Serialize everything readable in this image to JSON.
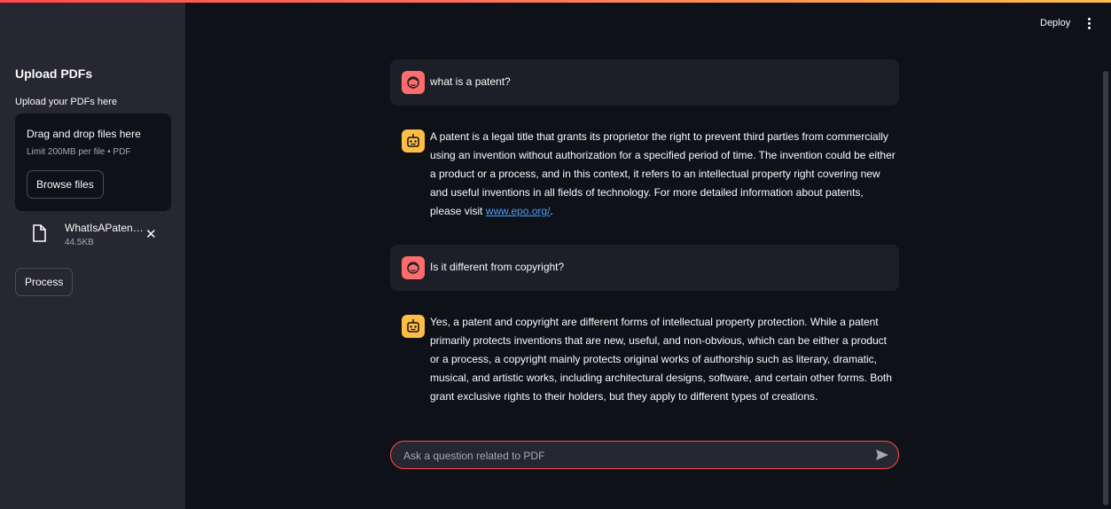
{
  "sidebar": {
    "title": "Upload PDFs",
    "upload_label": "Upload your PDFs here",
    "dropzone": {
      "title": "Drag and drop files here",
      "limit": "Limit 200MB per file • PDF",
      "browse_label": "Browse files"
    },
    "file": {
      "name": "WhatIsAPatent.pdf",
      "size": "44.5KB",
      "icon": "file-icon"
    },
    "process_label": "Process"
  },
  "header": {
    "deploy_label": "Deploy",
    "menu_icon": "kebab-menu-icon"
  },
  "chat": {
    "messages": [
      {
        "role": "user",
        "avatar_icon": "user-face-icon",
        "text": "what is a patent?"
      },
      {
        "role": "assistant",
        "avatar_icon": "bot-icon",
        "text": "A patent is a legal title that grants its proprietor the right to prevent third parties from commercially using an invention without authorization for a specified period of time. The invention could be either a product or a process, and in this context, it refers to an intellectual property right covering new and useful inventions in all fields of technology. For more detailed information about patents, please visit ",
        "link": "www.epo.org/",
        "suffix": "."
      },
      {
        "role": "user",
        "avatar_icon": "user-face-icon",
        "text": "Is it different from copyright?"
      },
      {
        "role": "assistant",
        "avatar_icon": "bot-icon",
        "text": "Yes, a patent and copyright are different forms of intellectual property protection. While a patent primarily protects inventions that are new, useful, and non-obvious, which can be either a product or a process, a copyright mainly protects original works of authorship such as literary, dramatic, musical, and artistic works, including architectural designs, software, and certain other forms. Both grant exclusive rights to their holders, but they apply to different types of creations."
      }
    ],
    "input": {
      "placeholder": "Ask a question related to PDF",
      "value": ""
    },
    "send_icon": "send-icon"
  },
  "colors": {
    "accent": "#ff4b4b",
    "user_avatar": "#ff6c6c",
    "bot_avatar": "#ffbd45",
    "background": "#0e1117",
    "sidebar": "#262730"
  }
}
